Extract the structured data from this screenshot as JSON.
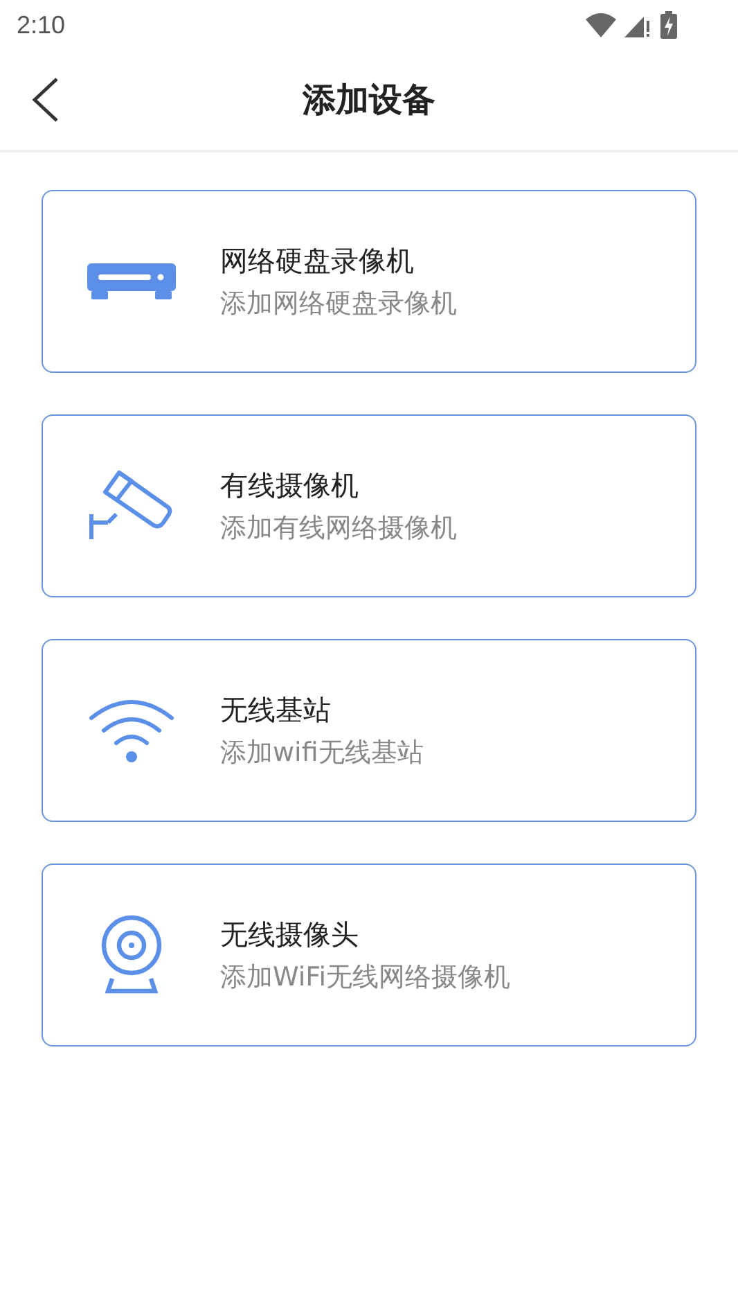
{
  "status_bar": {
    "time": "2:10"
  },
  "header": {
    "title": "添加设备"
  },
  "devices": [
    {
      "kind": "recorder",
      "title": "网络硬盘录像机",
      "subtitle": "添加网络硬盘录像机"
    },
    {
      "kind": "camera",
      "title": "有线摄像机",
      "subtitle": "添加有线网络摄像机"
    },
    {
      "kind": "wifi",
      "title": "无线基站",
      "subtitle": "添加wifi无线基站"
    },
    {
      "kind": "webcam",
      "title": "无线摄像头",
      "subtitle": "添加WiFi无线网络摄像机"
    }
  ]
}
